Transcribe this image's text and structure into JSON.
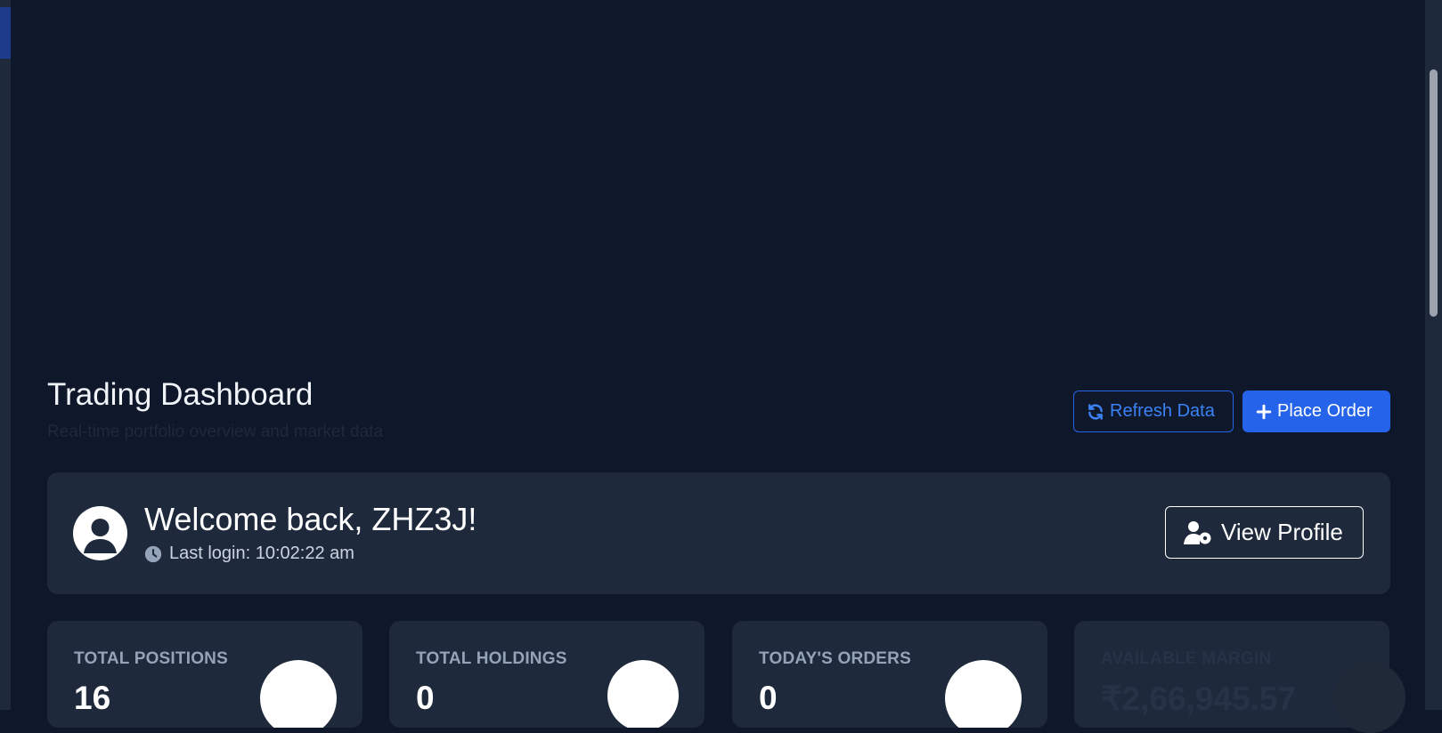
{
  "header": {
    "title": "Trading Dashboard",
    "subtitle": "Real-time portfolio overview and market data",
    "refresh_label": "Refresh Data",
    "place_order_label": "Place Order"
  },
  "welcome": {
    "greeting": "Welcome back, ZHZ3J!",
    "last_login": "Last login: 10:02:22 am",
    "view_profile_label": "View Profile"
  },
  "stats": [
    {
      "label": "TOTAL POSITIONS",
      "value": "16"
    },
    {
      "label": "TOTAL HOLDINGS",
      "value": "0"
    },
    {
      "label": "TODAY'S ORDERS",
      "value": "0"
    },
    {
      "label": "AVAILABLE MARGIN",
      "value": "₹2,66,945.57"
    }
  ],
  "colors": {
    "background": "#0f172a",
    "card": "#1e293b",
    "accent": "#2563eb"
  },
  "icons": {
    "refresh": "refresh-icon",
    "plus": "plus-icon",
    "avatar": "user-avatar-icon",
    "clock": "clock-icon",
    "profile": "user-gear-icon"
  }
}
